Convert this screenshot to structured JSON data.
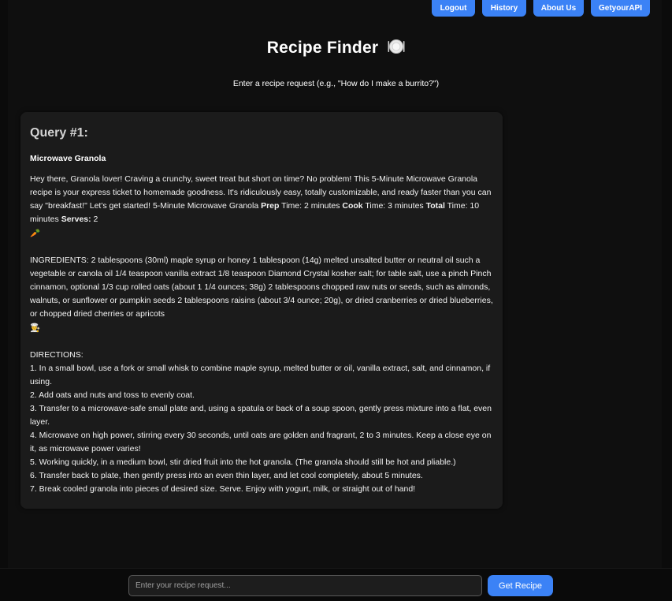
{
  "nav": {
    "logout": "Logout",
    "history": "History",
    "about": "About Us",
    "api": "GetyourAPI"
  },
  "header": {
    "title": "Recipe Finder",
    "title_icon": "plate-icon",
    "subtitle": "Enter a recipe request (e.g., \"How do I make a burrito?\")"
  },
  "result": {
    "query_heading": "Query #1:",
    "recipe_name": "Microwave Granola",
    "intro_a": "Hey there, Granola lover! Craving a crunchy, sweet treat but short on time? No problem! This 5-Minute Microwave Granola recipe is your express ticket to homemade goodness. It's ridiculously easy, totally customizable, and ready faster than you can say \"breakfast!\" Let's get started! 5-Minute Microwave Granola ",
    "prep_label": "Prep",
    "prep_value": " Time: 2 minutes ",
    "cook_label": "Cook",
    "cook_value": " Time: 3 minutes ",
    "total_label": "Total",
    "total_value": " Time: 10 minutes ",
    "serves_label": "Serves:",
    "serves_value": " 2",
    "emoji1": "🥕",
    "ingredients": "INGREDIENTS: 2 tablespoons (30ml) maple syrup or honey 1 tablespoon (14g) melted unsalted butter or neutral oil such a vegetable or canola oil 1/4 teaspoon vanilla extract 1/8 teaspoon Diamond Crystal kosher salt; for table salt, use a pinch Pinch cinnamon, optional 1/3 cup rolled oats (about 1 1/4 ounces; 38g) 2 tablespoons chopped raw nuts or seeds, such as almonds, walnuts, or sunflower or pumpkin seeds 2 tablespoons raisins (about 3/4 ounce; 20g), or dried cranberries or dried blueberries, or chopped dried cherries or apricots",
    "emoji2": "👨‍🍳",
    "directions_label": "DIRECTIONS:",
    "steps": [
      "1. In a small bowl, use a fork or small whisk to combine maple syrup, melted butter or oil, vanilla extract, salt, and cinnamon, if using.",
      "2. Add oats and nuts and toss to evenly coat.",
      "3. Transfer to a microwave-safe small plate and, using a spatula or back of a soup spoon, gently press mixture into a flat, even layer.",
      "4. Microwave on high power, stirring every 30 seconds, until oats are golden and fragrant, 2 to 3 minutes. Keep a close eye on it, as microwave power varies!",
      "5. Working quickly, in a medium bowl, stir dried fruit into the hot granola. (The granola should still be hot and pliable.)",
      "6. Transfer back to plate, then gently press into an even thin layer, and let cool completely, about 5 minutes.",
      "7. Break cooled granola into pieces of desired size. Serve. Enjoy with yogurt, milk, or straight out of hand!"
    ]
  },
  "input": {
    "placeholder": "Enter your recipe request...",
    "submit": "Get Recipe"
  },
  "colors": {
    "accent": "#3b82f6",
    "background": "#0b0b0b",
    "card": "#1b1b1b"
  }
}
